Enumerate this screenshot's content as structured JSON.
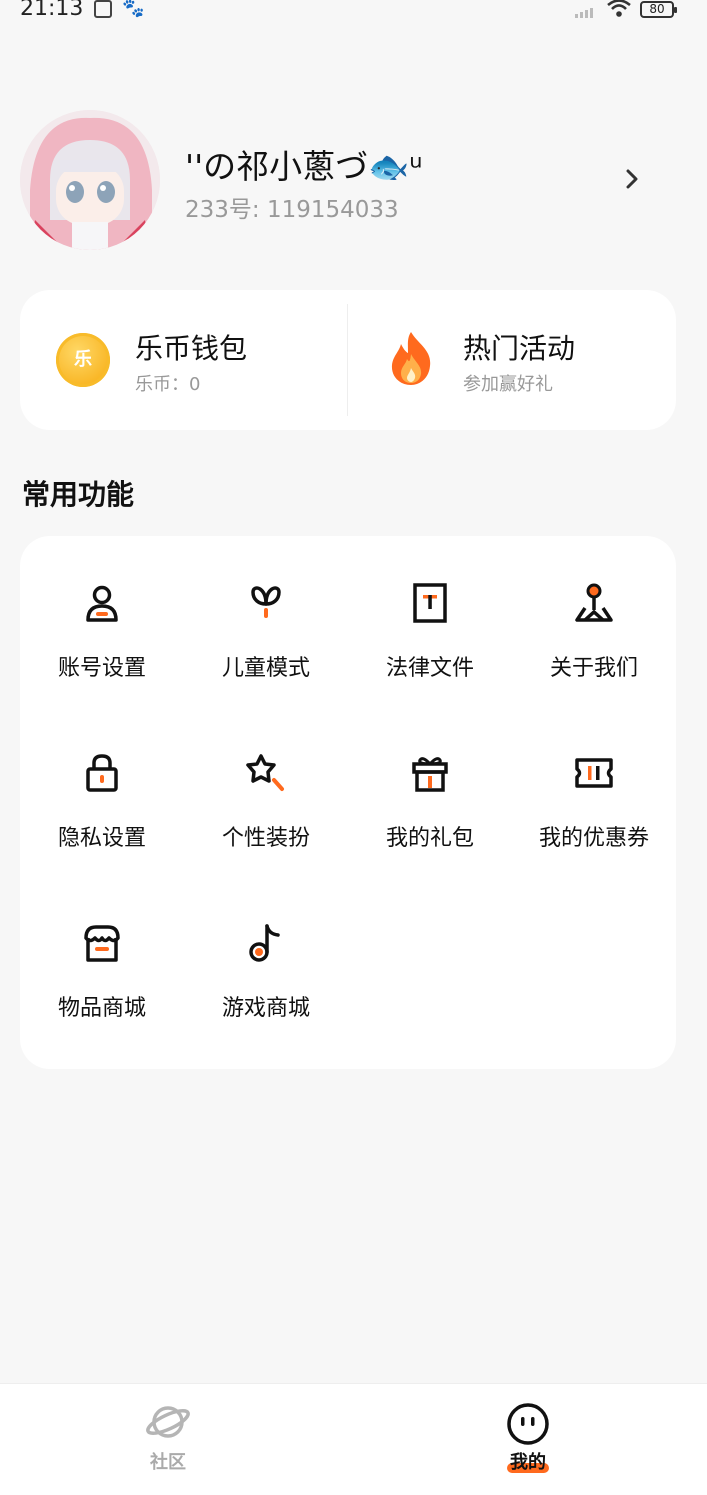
{
  "status_bar": {
    "time": "21:13",
    "battery": "80"
  },
  "profile": {
    "name": "''の祁小蔥づ🐟ᵘ",
    "id_text": "233号: 119154033"
  },
  "wallet": {
    "title": "乐币钱包",
    "subtitle": "乐币：0",
    "coin_glyph": "乐"
  },
  "activity": {
    "title": "热门活动",
    "subtitle": "参加赢好礼"
  },
  "section_title": "常用功能",
  "functions": [
    {
      "label": "账号设置",
      "icon": "account-icon"
    },
    {
      "label": "儿童模式",
      "icon": "child-mode-icon"
    },
    {
      "label": "法律文件",
      "icon": "legal-document-icon"
    },
    {
      "label": "关于我们",
      "icon": "about-us-icon"
    },
    {
      "label": "隐私设置",
      "icon": "lock-icon"
    },
    {
      "label": "个性装扮",
      "icon": "star-decor-icon"
    },
    {
      "label": "我的礼包",
      "icon": "gift-icon"
    },
    {
      "label": "我的优惠券",
      "icon": "coupon-icon"
    },
    {
      "label": "物品商城",
      "icon": "store-icon"
    },
    {
      "label": "游戏商城",
      "icon": "music-note-icon"
    }
  ],
  "tabs": [
    {
      "label": "社区",
      "icon": "planet-icon",
      "active": false
    },
    {
      "label": "我的",
      "icon": "face-icon",
      "active": true
    }
  ],
  "colors": {
    "accent": "#ff6a1e",
    "background": "#f7f7f7",
    "coin": "#f6a80b"
  }
}
